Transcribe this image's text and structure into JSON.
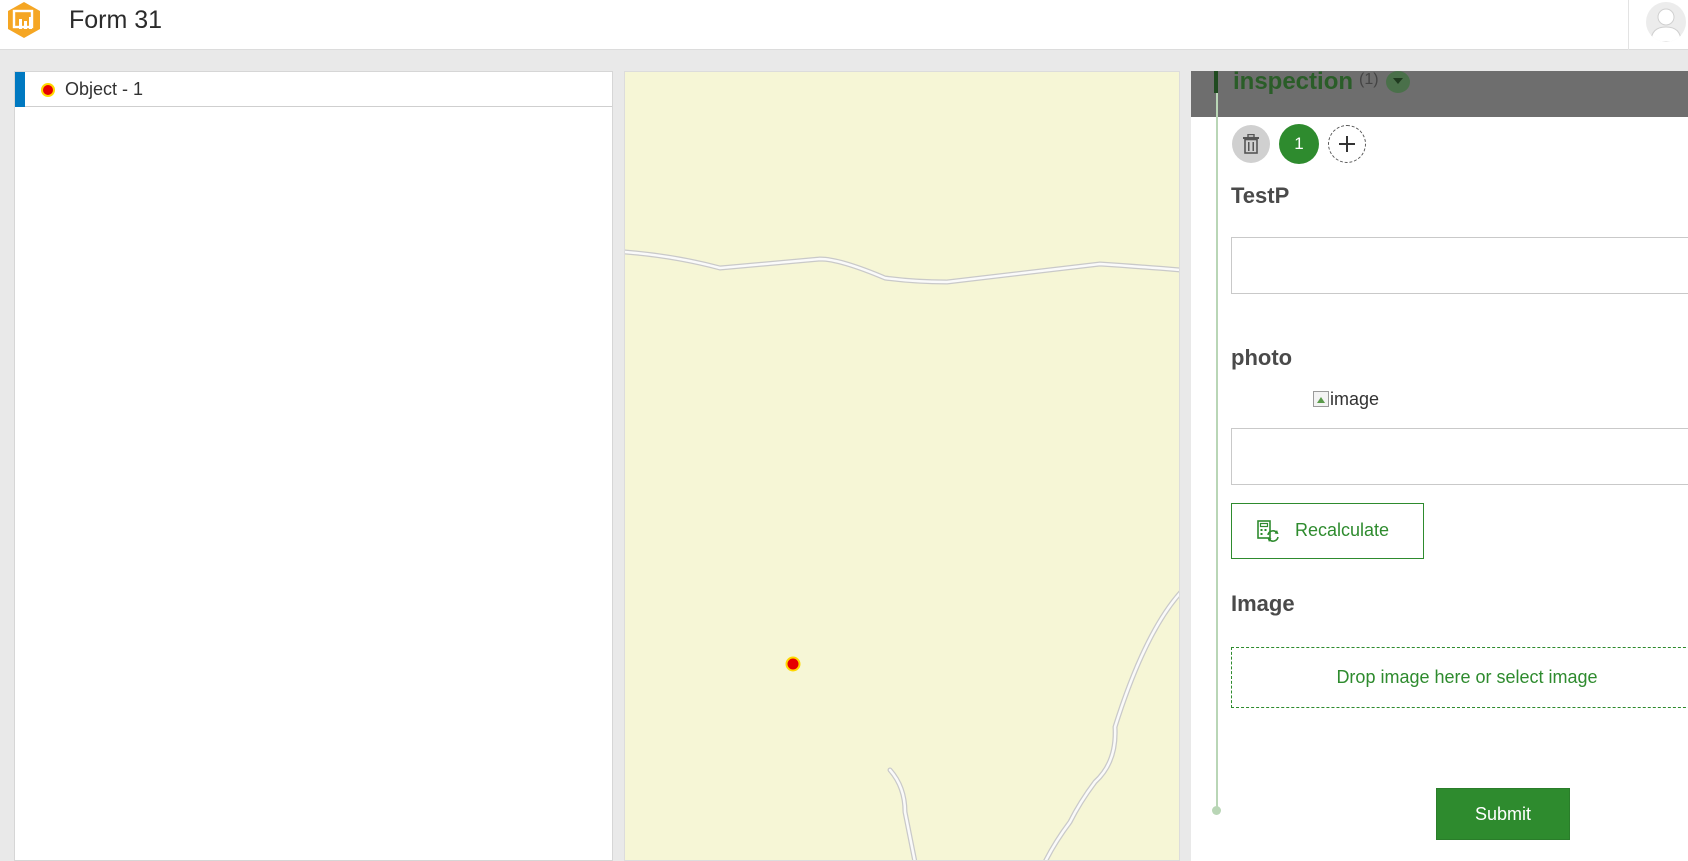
{
  "header": {
    "title": "Form 31"
  },
  "list": {
    "items": [
      {
        "label": "Object - 1"
      }
    ]
  },
  "form": {
    "group": {
      "title": "inspection",
      "count": "(1)"
    },
    "record_number": "1",
    "fields": {
      "testp_label": "TestP",
      "photo_label": "photo",
      "photo_alt": "image",
      "image_label": "Image"
    },
    "recalculate_label": "Recalculate",
    "drop_zone_text": "Drop image here or select image",
    "submit_label": "Submit"
  },
  "colors": {
    "accent_green": "#2e8b2e",
    "list_selected_bar": "#0079c1",
    "map_background": "#f6f6d6",
    "marker_fill": "#e60000",
    "marker_stroke": "#ffd800",
    "group_header": "#6e6e6e"
  },
  "icons": {
    "app": "survey123-app-icon",
    "user": "user-avatar-icon",
    "delete": "trash-icon",
    "add": "plus-icon",
    "recalculate": "recalculate-icon",
    "toggle": "chevron-down-icon"
  }
}
